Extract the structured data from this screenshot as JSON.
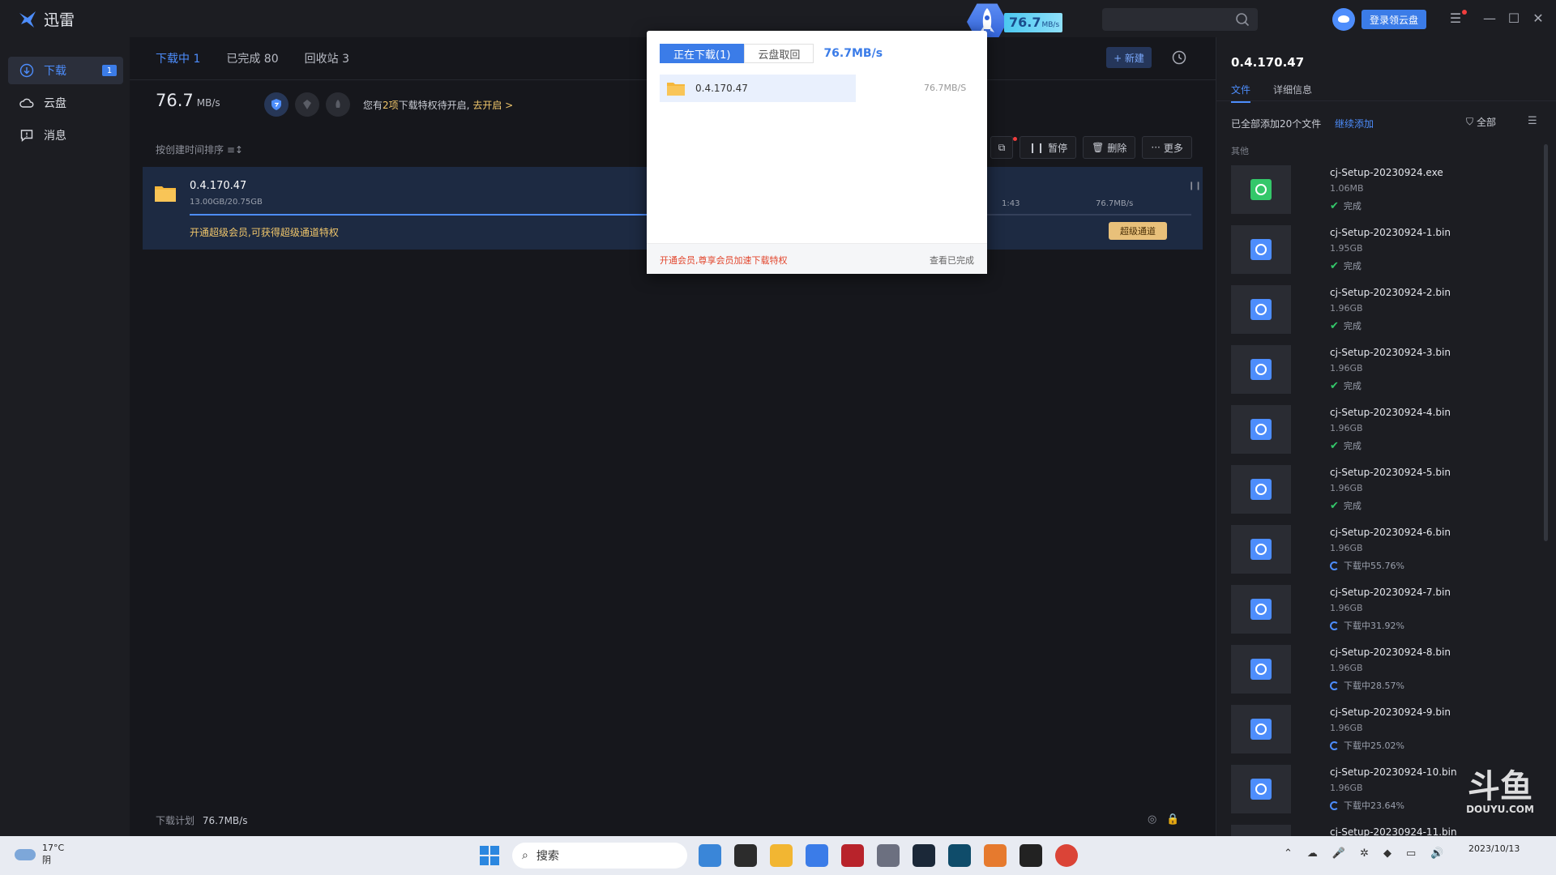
{
  "app": {
    "name": "迅雷"
  },
  "rocket": {
    "speed": "76.7",
    "unit": "MB/s"
  },
  "header": {
    "login_label": "登录领云盘"
  },
  "sidebar": {
    "items": [
      {
        "label": "下载",
        "badge": "1"
      },
      {
        "label": "云盘"
      },
      {
        "label": "消息"
      }
    ]
  },
  "main": {
    "tabs": [
      "下载中 1",
      "已完成 80",
      "回收站 3"
    ],
    "new_label": "+ 新建",
    "speed_value": "76.7",
    "speed_unit": "MB/s",
    "privilege_text_pre": "您有",
    "privilege_count": "2项",
    "privilege_text_post": "下载特权待开启,",
    "privilege_link": "去开启 >",
    "sort_label": "按创建时间排序",
    "toolbar": {
      "pause": "暂停",
      "delete": "删除",
      "more": "更多"
    },
    "task": {
      "name": "0.4.170.47",
      "size": "13.00GB/20.75GB",
      "progress": 0.627,
      "time": "1:43",
      "speed": "76.7MB/s",
      "promo": "开通超级会员,可获得超级通道特权",
      "super_label": "超级通道"
    },
    "footer": {
      "label": "下载计划",
      "value": "76.7MB/s"
    }
  },
  "popup": {
    "tab_active": "正在下载(1)",
    "tab_other": "云盘取回",
    "speed": "76.7MB/s",
    "item_name": "0.4.170.47",
    "item_speed": "76.7MB/S",
    "promo": "开通会员,尊享会员加速下载特权",
    "done_link": "查看已完成"
  },
  "panel": {
    "title": "0.4.170.47",
    "tabs": [
      "文件",
      "详细信息"
    ],
    "summary": "已全部添加20个文件",
    "add_link": "继续添加",
    "filter_label": "全部",
    "category": "其他",
    "files": [
      {
        "name": "cj-Setup-20230924.exe",
        "size": "1.06MB",
        "status": "完成",
        "done": true,
        "kind": "exe"
      },
      {
        "name": "cj-Setup-20230924-1.bin",
        "size": "1.95GB",
        "status": "完成",
        "done": true,
        "kind": "bin"
      },
      {
        "name": "cj-Setup-20230924-2.bin",
        "size": "1.96GB",
        "status": "完成",
        "done": true,
        "kind": "bin"
      },
      {
        "name": "cj-Setup-20230924-3.bin",
        "size": "1.96GB",
        "status": "完成",
        "done": true,
        "kind": "bin"
      },
      {
        "name": "cj-Setup-20230924-4.bin",
        "size": "1.96GB",
        "status": "完成",
        "done": true,
        "kind": "bin"
      },
      {
        "name": "cj-Setup-20230924-5.bin",
        "size": "1.96GB",
        "status": "完成",
        "done": true,
        "kind": "bin"
      },
      {
        "name": "cj-Setup-20230924-6.bin",
        "size": "1.96GB",
        "status": "下载中55.76%",
        "done": false,
        "kind": "bin"
      },
      {
        "name": "cj-Setup-20230924-7.bin",
        "size": "1.96GB",
        "status": "下载中31.92%",
        "done": false,
        "kind": "bin"
      },
      {
        "name": "cj-Setup-20230924-8.bin",
        "size": "1.96GB",
        "status": "下载中28.57%",
        "done": false,
        "kind": "bin"
      },
      {
        "name": "cj-Setup-20230924-9.bin",
        "size": "1.96GB",
        "status": "下载中25.02%",
        "done": false,
        "kind": "bin"
      },
      {
        "name": "cj-Setup-20230924-10.bin",
        "size": "1.96GB",
        "status": "下载中23.64%",
        "done": false,
        "kind": "bin"
      },
      {
        "name": "cj-Setup-20230924-11.bin",
        "size": "",
        "status": "",
        "done": false,
        "kind": "bin"
      }
    ]
  },
  "watermark": {
    "mark": "斗鱼",
    "url": "DOUYU.COM"
  },
  "taskbar": {
    "weather_temp": "17°C",
    "weather_desc": "阴",
    "search_label": "搜索",
    "date": "2023/10/13"
  },
  "colors": {
    "accent": "#4d8dfc",
    "gold": "#f0c66b",
    "success": "#34c76a",
    "promo_red": "#e2452c"
  }
}
